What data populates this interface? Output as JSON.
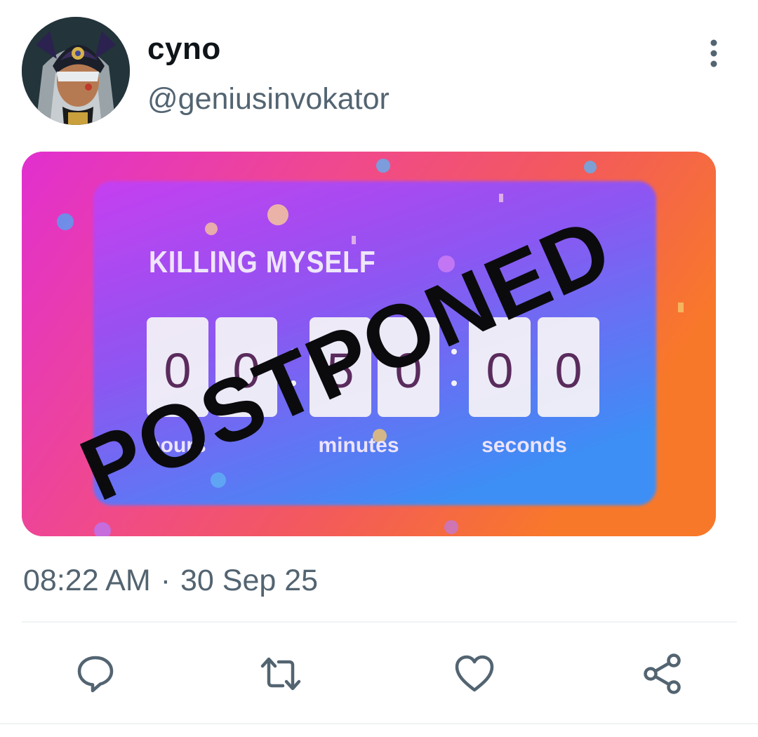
{
  "tweet": {
    "author": {
      "display_name": "cyno",
      "handle": "@geniusinvokator"
    },
    "media": {
      "title_text": "KILLING MYSELF",
      "digits": [
        "0",
        "0",
        "5",
        "0",
        "0",
        "0"
      ],
      "unit_labels": [
        "hours",
        "minutes",
        "seconds"
      ],
      "stamp_text": "POSTPONED"
    },
    "time": "08:22 AM",
    "separator": "·",
    "date": "30 Sep 25"
  },
  "icons": {
    "more": "more-vertical-icon",
    "reply": "reply-icon",
    "retweet": "retweet-icon",
    "like": "heart-icon",
    "share": "share-icon"
  },
  "colors": {
    "secondary_text": "#536471",
    "primary_text": "#0f1419",
    "divider": "#eff3f4"
  }
}
